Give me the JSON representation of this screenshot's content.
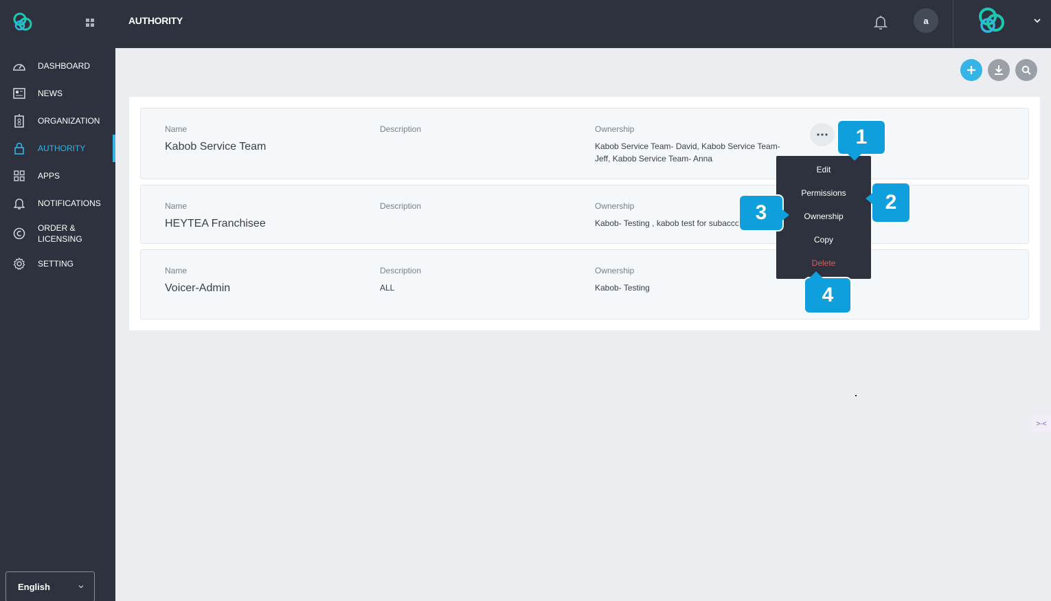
{
  "header": {
    "title": "AUTHORITY",
    "avatar_initial": "a"
  },
  "sidebar": {
    "items": [
      {
        "label": "DASHBOARD",
        "icon": "dashboard-icon"
      },
      {
        "label": "NEWS",
        "icon": "news-icon"
      },
      {
        "label": "ORGANIZATION",
        "icon": "organization-icon"
      },
      {
        "label": "AUTHORITY",
        "icon": "lock-icon",
        "active": true
      },
      {
        "label": "APPS",
        "icon": "apps-icon"
      },
      {
        "label": "NOTIFICATIONS",
        "icon": "bell-icon"
      },
      {
        "label_line1": "ORDER &",
        "label_line2": "LICENSING",
        "icon": "copyright-icon"
      },
      {
        "label": "SETTING",
        "icon": "gear-icon"
      }
    ],
    "language": "English"
  },
  "labels": {
    "name": "Name",
    "description": "Description",
    "ownership": "Ownership"
  },
  "roles": [
    {
      "name": "Kabob Service Team",
      "description": "",
      "ownership": "Kabob Service Team- David, Kabob Service Team-Jeff, Kabob Service Team- Anna"
    },
    {
      "name": "HEYTEA Franchisee",
      "description": "",
      "ownership": "Kabob- Testing , kabob test for subaccount"
    },
    {
      "name": "Voicer-Admin",
      "description": "ALL",
      "ownership": "Kabob- Testing"
    }
  ],
  "menu": {
    "edit": "Edit",
    "permissions": "Permissions",
    "ownership": "Ownership",
    "copy": "Copy",
    "delete": "Delete"
  },
  "callouts": {
    "c1": "1",
    "c2": "2",
    "c3": "3",
    "c4": "4"
  },
  "side_widget": ">-<",
  "colors": {
    "accent": "#35b4e6",
    "sidebar_bg": "#2d323e",
    "danger": "#e05b57",
    "callout": "#0e9fdc",
    "brand": "#1ec8b0"
  }
}
